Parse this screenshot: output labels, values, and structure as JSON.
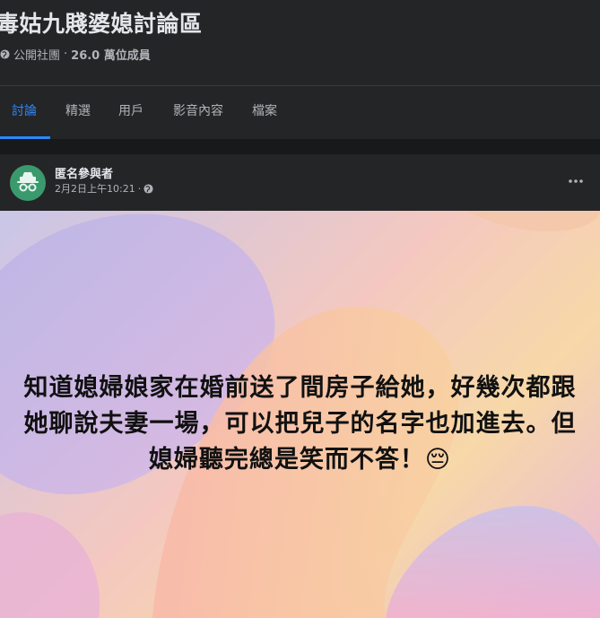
{
  "group": {
    "title": "毒姑九賤婆媳討論區",
    "privacy": "公開社團",
    "members": "26.0 萬位成員",
    "separator": "·"
  },
  "tabs": [
    {
      "label": "討論",
      "active": true
    },
    {
      "label": "精選",
      "active": false
    },
    {
      "label": "用戶",
      "active": false
    },
    {
      "label": "影音內容",
      "active": false
    },
    {
      "label": "檔案",
      "active": false
    }
  ],
  "post": {
    "author": "匿名參與者",
    "timestamp": "2月2日上午10:21",
    "separator": "·",
    "text": "知道媳婦娘家在婚前送了間房子給她，好幾次都跟她聊說夫妻一場，可以把兒子的名字也加進去。但媳婦聽完總是笑而不答！😔"
  },
  "colors": {
    "accent": "#2d88ff",
    "surface": "#242526",
    "background": "#18191a"
  },
  "icons": {
    "privacy": "globe-icon",
    "more": "more-horizontal-icon",
    "avatar": "anonymous-incognito-icon"
  }
}
